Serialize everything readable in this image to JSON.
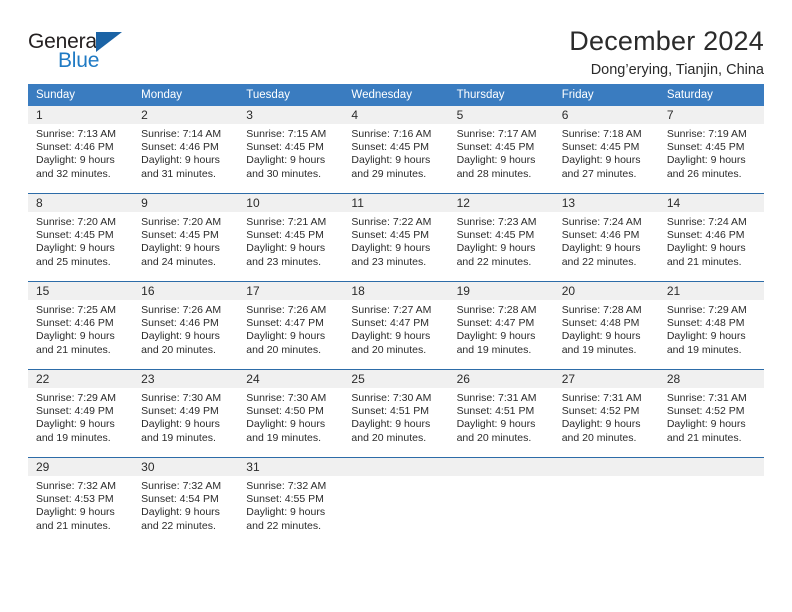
{
  "brand": {
    "name_part1": "General",
    "name_part2": "Blue",
    "triangle_icon": "triangle-icon",
    "colors": {
      "dark": "#231f20",
      "blue": "#1f7ac4",
      "triangle": "#1b63a5"
    }
  },
  "header": {
    "title": "December 2024",
    "subtitle": "Dong’erying, Tianjin, China"
  },
  "theme": {
    "header_blue": "#3a7cc0",
    "row_border": "#2d6ca8",
    "daynum_band": "#f0f0f0",
    "text": "#2b2b2b"
  },
  "calendar": {
    "weekday_headers": [
      "Sunday",
      "Monday",
      "Tuesday",
      "Wednesday",
      "Thursday",
      "Friday",
      "Saturday"
    ],
    "weeks": [
      [
        {
          "day": "1",
          "sunrise": "Sunrise: 7:13 AM",
          "sunset": "Sunset: 4:46 PM",
          "daylight_line1": "Daylight: 9 hours",
          "daylight_line2": "and 32 minutes."
        },
        {
          "day": "2",
          "sunrise": "Sunrise: 7:14 AM",
          "sunset": "Sunset: 4:46 PM",
          "daylight_line1": "Daylight: 9 hours",
          "daylight_line2": "and 31 minutes."
        },
        {
          "day": "3",
          "sunrise": "Sunrise: 7:15 AM",
          "sunset": "Sunset: 4:45 PM",
          "daylight_line1": "Daylight: 9 hours",
          "daylight_line2": "and 30 minutes."
        },
        {
          "day": "4",
          "sunrise": "Sunrise: 7:16 AM",
          "sunset": "Sunset: 4:45 PM",
          "daylight_line1": "Daylight: 9 hours",
          "daylight_line2": "and 29 minutes."
        },
        {
          "day": "5",
          "sunrise": "Sunrise: 7:17 AM",
          "sunset": "Sunset: 4:45 PM",
          "daylight_line1": "Daylight: 9 hours",
          "daylight_line2": "and 28 minutes."
        },
        {
          "day": "6",
          "sunrise": "Sunrise: 7:18 AM",
          "sunset": "Sunset: 4:45 PM",
          "daylight_line1": "Daylight: 9 hours",
          "daylight_line2": "and 27 minutes."
        },
        {
          "day": "7",
          "sunrise": "Sunrise: 7:19 AM",
          "sunset": "Sunset: 4:45 PM",
          "daylight_line1": "Daylight: 9 hours",
          "daylight_line2": "and 26 minutes."
        }
      ],
      [
        {
          "day": "8",
          "sunrise": "Sunrise: 7:20 AM",
          "sunset": "Sunset: 4:45 PM",
          "daylight_line1": "Daylight: 9 hours",
          "daylight_line2": "and 25 minutes."
        },
        {
          "day": "9",
          "sunrise": "Sunrise: 7:20 AM",
          "sunset": "Sunset: 4:45 PM",
          "daylight_line1": "Daylight: 9 hours",
          "daylight_line2": "and 24 minutes."
        },
        {
          "day": "10",
          "sunrise": "Sunrise: 7:21 AM",
          "sunset": "Sunset: 4:45 PM",
          "daylight_line1": "Daylight: 9 hours",
          "daylight_line2": "and 23 minutes."
        },
        {
          "day": "11",
          "sunrise": "Sunrise: 7:22 AM",
          "sunset": "Sunset: 4:45 PM",
          "daylight_line1": "Daylight: 9 hours",
          "daylight_line2": "and 23 minutes."
        },
        {
          "day": "12",
          "sunrise": "Sunrise: 7:23 AM",
          "sunset": "Sunset: 4:45 PM",
          "daylight_line1": "Daylight: 9 hours",
          "daylight_line2": "and 22 minutes."
        },
        {
          "day": "13",
          "sunrise": "Sunrise: 7:24 AM",
          "sunset": "Sunset: 4:46 PM",
          "daylight_line1": "Daylight: 9 hours",
          "daylight_line2": "and 22 minutes."
        },
        {
          "day": "14",
          "sunrise": "Sunrise: 7:24 AM",
          "sunset": "Sunset: 4:46 PM",
          "daylight_line1": "Daylight: 9 hours",
          "daylight_line2": "and 21 minutes."
        }
      ],
      [
        {
          "day": "15",
          "sunrise": "Sunrise: 7:25 AM",
          "sunset": "Sunset: 4:46 PM",
          "daylight_line1": "Daylight: 9 hours",
          "daylight_line2": "and 21 minutes."
        },
        {
          "day": "16",
          "sunrise": "Sunrise: 7:26 AM",
          "sunset": "Sunset: 4:46 PM",
          "daylight_line1": "Daylight: 9 hours",
          "daylight_line2": "and 20 minutes."
        },
        {
          "day": "17",
          "sunrise": "Sunrise: 7:26 AM",
          "sunset": "Sunset: 4:47 PM",
          "daylight_line1": "Daylight: 9 hours",
          "daylight_line2": "and 20 minutes."
        },
        {
          "day": "18",
          "sunrise": "Sunrise: 7:27 AM",
          "sunset": "Sunset: 4:47 PM",
          "daylight_line1": "Daylight: 9 hours",
          "daylight_line2": "and 20 minutes."
        },
        {
          "day": "19",
          "sunrise": "Sunrise: 7:28 AM",
          "sunset": "Sunset: 4:47 PM",
          "daylight_line1": "Daylight: 9 hours",
          "daylight_line2": "and 19 minutes."
        },
        {
          "day": "20",
          "sunrise": "Sunrise: 7:28 AM",
          "sunset": "Sunset: 4:48 PM",
          "daylight_line1": "Daylight: 9 hours",
          "daylight_line2": "and 19 minutes."
        },
        {
          "day": "21",
          "sunrise": "Sunrise: 7:29 AM",
          "sunset": "Sunset: 4:48 PM",
          "daylight_line1": "Daylight: 9 hours",
          "daylight_line2": "and 19 minutes."
        }
      ],
      [
        {
          "day": "22",
          "sunrise": "Sunrise: 7:29 AM",
          "sunset": "Sunset: 4:49 PM",
          "daylight_line1": "Daylight: 9 hours",
          "daylight_line2": "and 19 minutes."
        },
        {
          "day": "23",
          "sunrise": "Sunrise: 7:30 AM",
          "sunset": "Sunset: 4:49 PM",
          "daylight_line1": "Daylight: 9 hours",
          "daylight_line2": "and 19 minutes."
        },
        {
          "day": "24",
          "sunrise": "Sunrise: 7:30 AM",
          "sunset": "Sunset: 4:50 PM",
          "daylight_line1": "Daylight: 9 hours",
          "daylight_line2": "and 19 minutes."
        },
        {
          "day": "25",
          "sunrise": "Sunrise: 7:30 AM",
          "sunset": "Sunset: 4:51 PM",
          "daylight_line1": "Daylight: 9 hours",
          "daylight_line2": "and 20 minutes."
        },
        {
          "day": "26",
          "sunrise": "Sunrise: 7:31 AM",
          "sunset": "Sunset: 4:51 PM",
          "daylight_line1": "Daylight: 9 hours",
          "daylight_line2": "and 20 minutes."
        },
        {
          "day": "27",
          "sunrise": "Sunrise: 7:31 AM",
          "sunset": "Sunset: 4:52 PM",
          "daylight_line1": "Daylight: 9 hours",
          "daylight_line2": "and 20 minutes."
        },
        {
          "day": "28",
          "sunrise": "Sunrise: 7:31 AM",
          "sunset": "Sunset: 4:52 PM",
          "daylight_line1": "Daylight: 9 hours",
          "daylight_line2": "and 21 minutes."
        }
      ],
      [
        {
          "day": "29",
          "sunrise": "Sunrise: 7:32 AM",
          "sunset": "Sunset: 4:53 PM",
          "daylight_line1": "Daylight: 9 hours",
          "daylight_line2": "and 21 minutes."
        },
        {
          "day": "30",
          "sunrise": "Sunrise: 7:32 AM",
          "sunset": "Sunset: 4:54 PM",
          "daylight_line1": "Daylight: 9 hours",
          "daylight_line2": "and 22 minutes."
        },
        {
          "day": "31",
          "sunrise": "Sunrise: 7:32 AM",
          "sunset": "Sunset: 4:55 PM",
          "daylight_line1": "Daylight: 9 hours",
          "daylight_line2": "and 22 minutes."
        },
        {
          "day": "",
          "sunrise": "",
          "sunset": "",
          "daylight_line1": "",
          "daylight_line2": ""
        },
        {
          "day": "",
          "sunrise": "",
          "sunset": "",
          "daylight_line1": "",
          "daylight_line2": ""
        },
        {
          "day": "",
          "sunrise": "",
          "sunset": "",
          "daylight_line1": "",
          "daylight_line2": ""
        },
        {
          "day": "",
          "sunrise": "",
          "sunset": "",
          "daylight_line1": "",
          "daylight_line2": ""
        }
      ]
    ]
  }
}
